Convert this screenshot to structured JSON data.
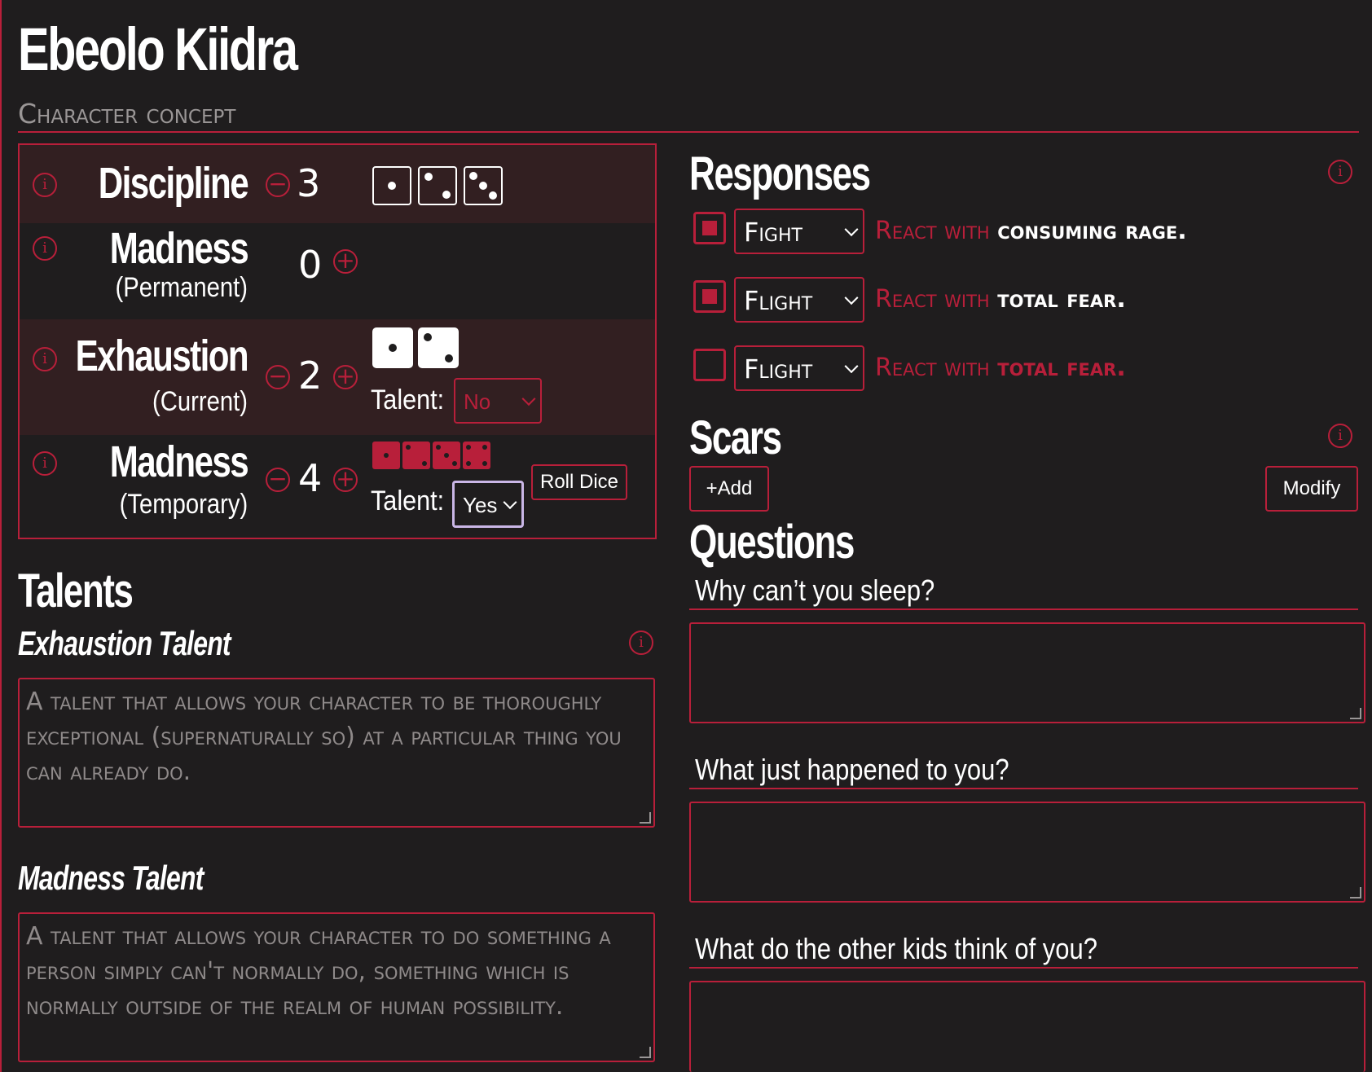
{
  "character": {
    "name": "Ebeolo Kiidra",
    "concept_placeholder": "Character concept"
  },
  "stats": {
    "discipline": {
      "label": "Discipline",
      "value": "3",
      "minus": "−",
      "dice_faces": [
        1,
        2,
        3
      ]
    },
    "madness_permanent": {
      "label": "Madness",
      "sublabel": "(Permanent)",
      "value": "0",
      "plus": "+"
    },
    "exhaustion": {
      "label": "Exhaustion",
      "sublabel": "(Current)",
      "value": "2",
      "minus": "−",
      "plus": "+",
      "dice_faces": [
        1,
        2
      ],
      "talent_label": "Talent:",
      "talent_value": "No"
    },
    "madness_temporary": {
      "label": "Madness",
      "sublabel": "(Temporary)",
      "value": "4",
      "minus": "−",
      "plus": "+",
      "dice_faces": [
        1,
        2,
        3,
        4
      ],
      "talent_label": "Talent:",
      "talent_value": "Yes"
    },
    "roll_dice_label": "Roll Dice",
    "info_glyph": "i"
  },
  "talents": {
    "heading": "Talents",
    "exhaustion": {
      "heading": "Exhaustion Talent",
      "placeholder": "A talent that allows your character to be thoroughly exceptional (supernaturally so) at a particular thing you can already do."
    },
    "madness": {
      "heading": "Madness Talent",
      "placeholder": "A talent that allows your character to do something a person simply can't normally do, something which is normally outside of the realm of human possibility."
    }
  },
  "responses": {
    "heading": "Responses",
    "items": [
      {
        "checked": true,
        "value": "Fight",
        "prefix": "React with",
        "effect": "consuming rage."
      },
      {
        "checked": true,
        "value": "Flight",
        "prefix": "React with",
        "effect": "total fear."
      },
      {
        "checked": false,
        "value": "Flight",
        "prefix": "React with",
        "effect": "total fear."
      }
    ]
  },
  "scars": {
    "heading": "Scars",
    "add_label": "+Add",
    "modify_label": "Modify"
  },
  "questions": {
    "heading": "Questions",
    "items": [
      {
        "label": "Why can’t you sleep?",
        "answer": ""
      },
      {
        "label": "What just happened to you?",
        "answer": ""
      },
      {
        "label": "What do the other kids think of you?",
        "answer": ""
      }
    ]
  },
  "colors": {
    "accent": "#b81f3a",
    "background": "#1f1d1e",
    "row_dark": "#321f21",
    "muted_text": "#9a9696"
  }
}
